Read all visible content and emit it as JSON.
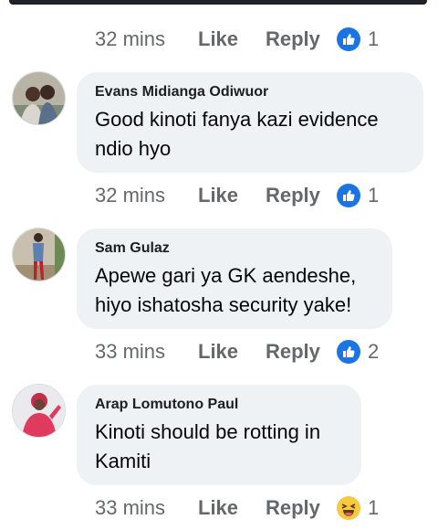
{
  "comments": [
    {
      "author": "",
      "text": "",
      "time": "32 mins",
      "like_label": "Like",
      "reply_label": "Reply",
      "reaction": "like",
      "reaction_count": "1"
    },
    {
      "author": "Evans Midianga Odiwuor",
      "text_lines": [
        "Good kinoti fanya kazi evidence",
        "ndio hyo"
      ],
      "time": "32 mins",
      "like_label": "Like",
      "reply_label": "Reply",
      "reaction": "like",
      "reaction_count": "1"
    },
    {
      "author": "Sam Gulaz",
      "text_lines": [
        "Apewe gari ya GK aendeshe,",
        "hiyo ishatosha security yake!"
      ],
      "time": "33 mins",
      "like_label": "Like",
      "reply_label": "Reply",
      "reaction": "like",
      "reaction_count": "2"
    },
    {
      "author": "Arap Lomutono Paul",
      "text_lines": [
        "Kinoti should be rotting in",
        "Kamiti"
      ],
      "time": "33 mins",
      "like_label": "Like",
      "reply_label": "Reply",
      "reaction": "haha",
      "reaction_count": "1"
    }
  ],
  "colors": {
    "bubble": "#eff2f5",
    "meta_text": "#65676b",
    "like_reaction": "#1b74e4",
    "haha_reaction": "#f7c93e"
  }
}
